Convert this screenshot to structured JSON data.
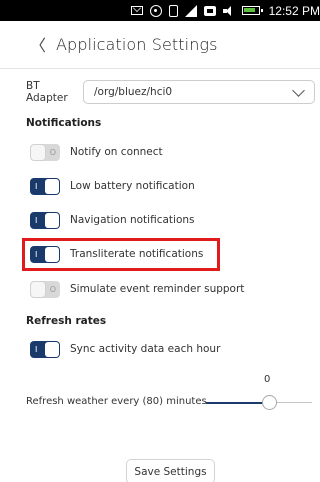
{
  "status_bar": {
    "time": "12:52 PM",
    "icons": [
      "envelope-icon",
      "hotspot-icon",
      "bluetooth-icon",
      "signal-icon",
      "network-icon",
      "volume-icon",
      "battery-icon"
    ]
  },
  "header": {
    "back_glyph": "〈",
    "title": "Application Settings"
  },
  "adapter": {
    "label": "BT Adapter",
    "value": "/org/bluez/hci0"
  },
  "notifications": {
    "title": "Notifications",
    "items": [
      {
        "label": "Notify on connect",
        "on": false
      },
      {
        "label": "Low battery notification",
        "on": true
      },
      {
        "label": "Navigation notifications",
        "on": true
      },
      {
        "label": "Transliterate notifications",
        "on": true
      },
      {
        "label": "Simulate event reminder support",
        "on": false
      }
    ]
  },
  "refresh": {
    "title": "Refresh rates",
    "items": [
      {
        "label": "Sync activity data each hour",
        "on": true
      }
    ],
    "weather_label": "Refresh weather every (80) minutes",
    "weather_value": "0",
    "weather_fraction": 0.6
  },
  "toggle_marks": {
    "on": "I",
    "off": "O"
  },
  "colors": {
    "accent": "#1a3a6b",
    "highlight": "#e11b1b"
  },
  "save_label": "Save Settings"
}
